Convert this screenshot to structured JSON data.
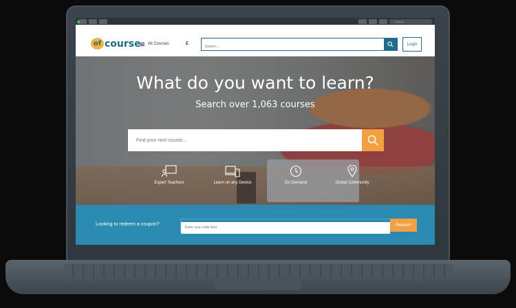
{
  "browser": {
    "search_placeholder": "Search"
  },
  "brand": {
    "logo_mark": "of",
    "logo_word": "course",
    "primary_color": "#1d6c8c",
    "accent_color": "#f4a040"
  },
  "nav": {
    "menu_label": "All Courses",
    "currency_symbol": "£",
    "search_placeholder": "Search...",
    "login_label": "Login"
  },
  "hero": {
    "title": "What do you want to learn?",
    "subtitle": "Search over 1,063 courses",
    "search_placeholder": "Find your next course...",
    "features": [
      {
        "label": "Expert Teachers",
        "icon": "teacher-icon"
      },
      {
        "label": "Learn on any Device",
        "icon": "devices-icon"
      },
      {
        "label": "On Demand",
        "icon": "clock-icon"
      },
      {
        "label": "Global Community",
        "icon": "location-pin-icon"
      }
    ]
  },
  "coupon": {
    "label": "Looking to redeem a coupon?",
    "input_placeholder": "Enter your code here",
    "button_label": "Redeem"
  }
}
